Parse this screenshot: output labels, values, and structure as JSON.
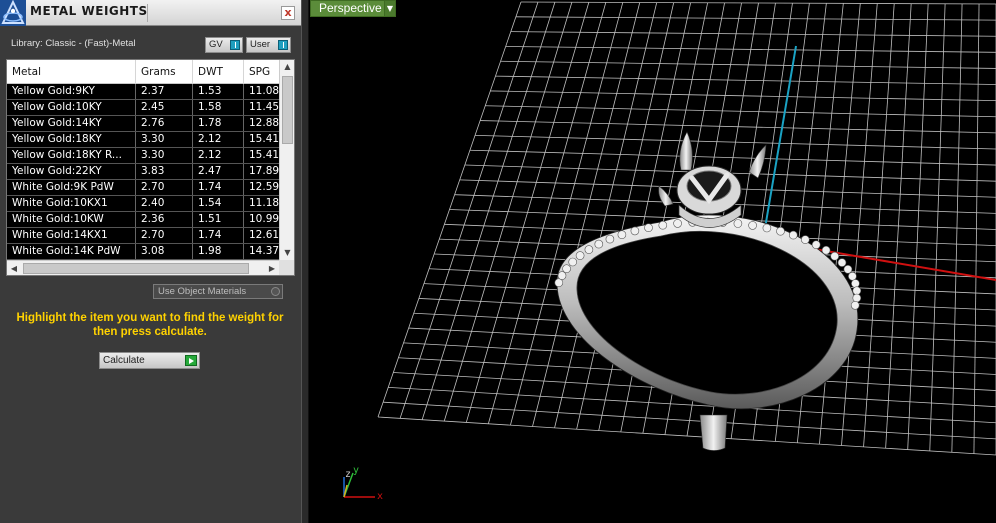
{
  "panel": {
    "title": "METAL WEIGHTS",
    "close_label": "x",
    "library_label": "Library: Classic - (Fast)-Metal",
    "gv_label": "GV",
    "user_label": "User",
    "columns": [
      "Metal",
      "Grams",
      "DWT",
      "SPG"
    ],
    "rows": [
      {
        "metal": "Yellow Gold:9KY",
        "grams": "2.37",
        "dwt": "1.53",
        "spg": "11.08"
      },
      {
        "metal": "Yellow Gold:10KY",
        "grams": "2.45",
        "dwt": "1.58",
        "spg": "11.45"
      },
      {
        "metal": "Yellow Gold:14KY",
        "grams": "2.76",
        "dwt": "1.78",
        "spg": "12.88"
      },
      {
        "metal": "Yellow Gold:18KY",
        "grams": "3.30",
        "dwt": "2.12",
        "spg": "15.41"
      },
      {
        "metal": "Yellow Gold:18KY R...",
        "grams": "3.30",
        "dwt": "2.12",
        "spg": "15.41"
      },
      {
        "metal": "Yellow Gold:22KY",
        "grams": "3.83",
        "dwt": "2.47",
        "spg": "17.89"
      },
      {
        "metal": "White Gold:9K PdW",
        "grams": "2.70",
        "dwt": "1.74",
        "spg": "12.59"
      },
      {
        "metal": "White Gold:10KX1",
        "grams": "2.40",
        "dwt": "1.54",
        "spg": "11.18"
      },
      {
        "metal": "White Gold:10KW",
        "grams": "2.36",
        "dwt": "1.51",
        "spg": "10.99"
      },
      {
        "metal": "White Gold:14KX1",
        "grams": "2.70",
        "dwt": "1.74",
        "spg": "12.61"
      },
      {
        "metal": "White Gold:14K PdW",
        "grams": "3.08",
        "dwt": "1.98",
        "spg": "14.37"
      }
    ],
    "use_object_materials_label": "Use Object Materials",
    "hint": "Highlight the item you want to find the weight for then press calculate.",
    "calculate_label": "Calculate"
  },
  "viewport": {
    "view_label": "Perspective",
    "axis_labels": {
      "x": "x",
      "y": "y",
      "z": "z"
    }
  },
  "colors": {
    "hint": "#ffd200",
    "view_tab": "#5b8c3a",
    "grid": "#bfbfbf",
    "x_axis": "#d01010",
    "y_axis": "#1aa3c4"
  }
}
